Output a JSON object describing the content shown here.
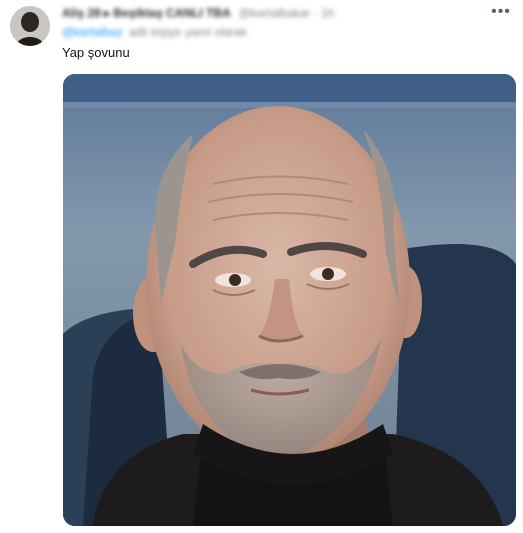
{
  "tweet": {
    "author_name": "Aliş 28 ▸ Beşiktaş CANLI TBA",
    "author_handle": "@kartalbakar · 1h",
    "reply_handle": "@kartalbaz",
    "reply_rest": "adlı kişiye yanıt olarak",
    "text": "Yap şovunu",
    "more_icon": "more-horizontal-icon",
    "media_alt": "photo of a bald man with grey stubble"
  }
}
